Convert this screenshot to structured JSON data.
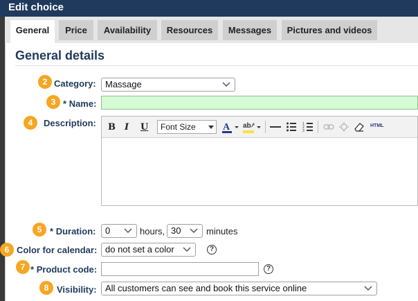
{
  "window": {
    "title": "Edit choice"
  },
  "tabs": [
    {
      "label": "General"
    },
    {
      "label": "Price"
    },
    {
      "label": "Availability"
    },
    {
      "label": "Resources"
    },
    {
      "label": "Messages"
    },
    {
      "label": "Pictures and videos"
    }
  ],
  "section": {
    "title": "General details"
  },
  "fields": {
    "category": {
      "badge": "2",
      "label": "Category:",
      "value": "Massage"
    },
    "name": {
      "badge": "3",
      "required": "*",
      "label": "Name:",
      "value": ""
    },
    "description": {
      "badge": "4",
      "label": "Description:"
    },
    "duration": {
      "badge": "5",
      "required": "*",
      "label": "Duration:",
      "hours_value": "0",
      "hours_unit": "hours,",
      "minutes_value": "30",
      "minutes_unit": "minutes"
    },
    "color": {
      "badge": "6",
      "label": "Color for calendar:",
      "value": "do not set a color"
    },
    "product_code": {
      "badge": "7",
      "required": "*",
      "label": "Product code:",
      "value": ""
    },
    "visibility": {
      "badge": "8",
      "label": "Visibility:",
      "value": "All customers can see and book this service online"
    }
  },
  "editor_toolbar": {
    "bold": "B",
    "italic": "I",
    "underline": "U",
    "font_size": "Font Size",
    "html": "HTML"
  },
  "help_glyph": "?",
  "colors": {
    "title_bar": "#1f3a5c",
    "badge": "#f5a623",
    "name_field_bg": "#d4fbd4"
  }
}
